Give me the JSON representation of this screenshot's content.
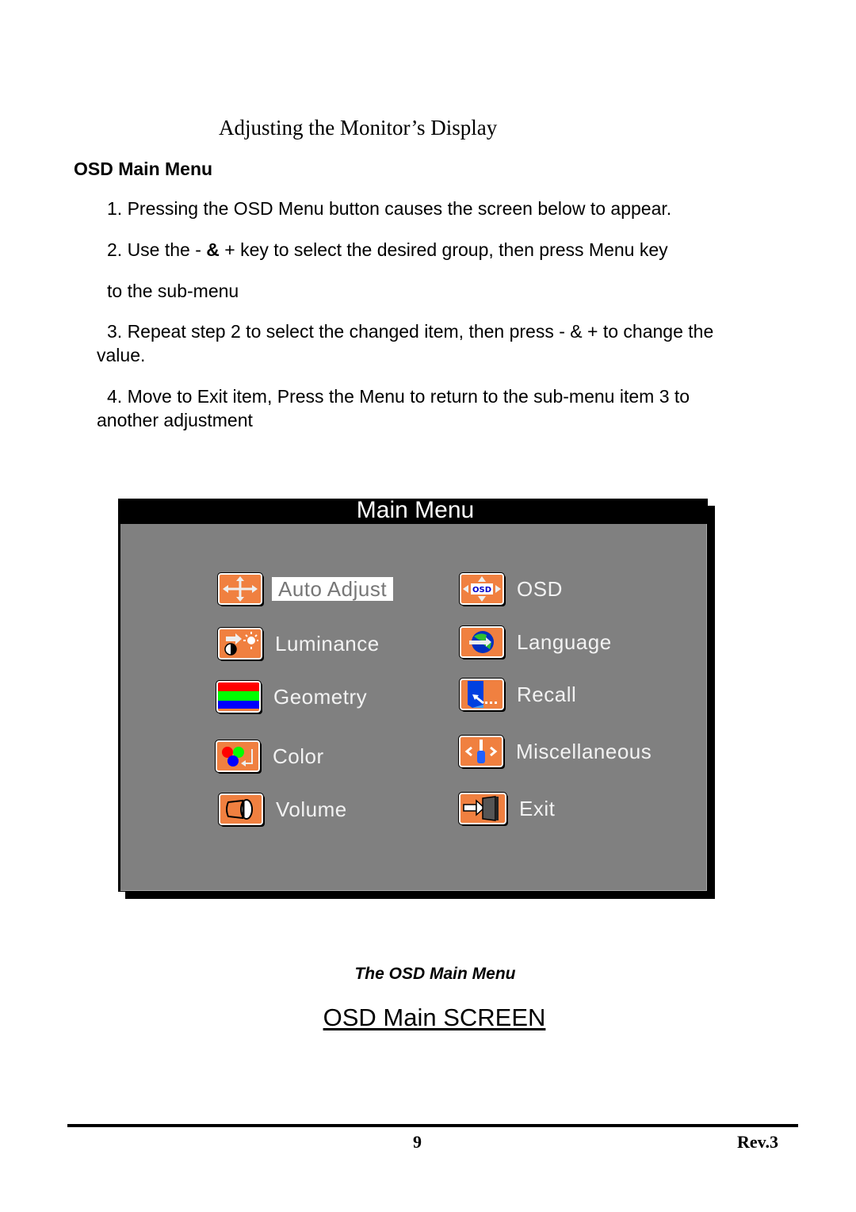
{
  "header": {
    "title": "Adjusting the Monitor’s Display"
  },
  "section": {
    "heading": "OSD Main Menu"
  },
  "steps": [
    {
      "text": "1. Pressing the OSD Menu button causes the screen below to appear."
    },
    {
      "prefix": "2. Use the - ",
      "bold": "&",
      "suffix": " + key to select the desired group, then press Menu key"
    },
    {
      "text": "to the sub-menu"
    },
    {
      "line1": "3. Repeat step 2 to select the changed item, then press - & + to change the",
      "line2": "value."
    },
    {
      "line1": "4. Move to Exit item, Press the Menu to return to the sub-menu item 3 to",
      "line2": "another adjustment"
    }
  ],
  "osd": {
    "title": "Main Menu",
    "colors": {
      "icon_bg": "#f08040",
      "panel": "#808080",
      "titlebar": "#000000",
      "selected_bg": "#ffffff"
    },
    "items": [
      {
        "label": "Auto Adjust",
        "icon": "move-arrows-icon",
        "selected": true
      },
      {
        "label": "Luminance",
        "icon": "brightness-icon",
        "selected": false
      },
      {
        "label": "Geometry",
        "icon": "rgb-stripes-icon",
        "selected": false
      },
      {
        "label": "Color",
        "icon": "color-circles-icon",
        "selected": false
      },
      {
        "label": "Volume",
        "icon": "speaker-icon",
        "selected": false
      },
      {
        "label": "OSD",
        "icon": "osd-position-icon",
        "selected": false
      },
      {
        "label": "Language",
        "icon": "globe-icon",
        "selected": false
      },
      {
        "label": "Recall",
        "icon": "recall-icon",
        "selected": false
      },
      {
        "label": "Miscellaneous",
        "icon": "tools-icon",
        "selected": false
      },
      {
        "label": "Exit",
        "icon": "exit-door-icon",
        "selected": false
      }
    ]
  },
  "caption": "The OSD Main Menu",
  "screen_title": "OSD Main SCREEN",
  "footer": {
    "page": "9",
    "revision": "Rev.3"
  }
}
